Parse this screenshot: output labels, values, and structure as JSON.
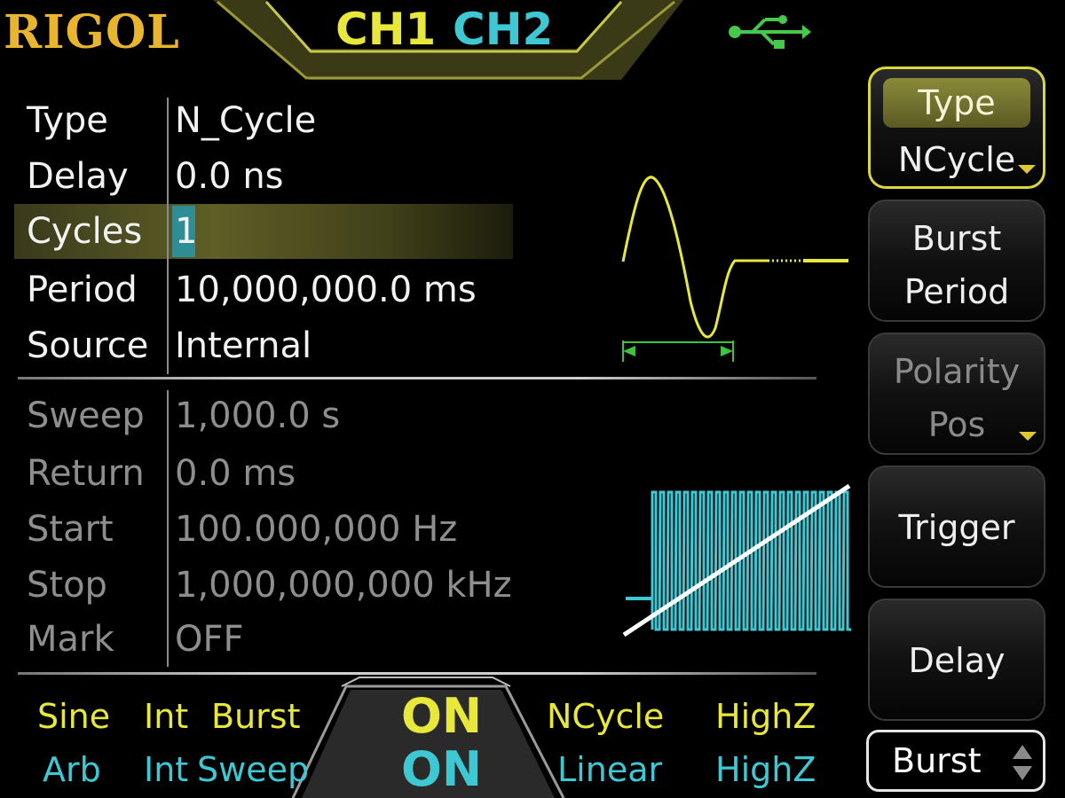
{
  "header": {
    "logo": "RIGOL",
    "channel1": "CH1",
    "channel2": "CH2",
    "usb_icon": "usb-icon",
    "colors": {
      "ch1": "#e8e83a",
      "ch2": "#3ec8d4",
      "logo": "#e8b52c"
    }
  },
  "burst": {
    "rows": [
      {
        "label": "Type",
        "value": "N_Cycle"
      },
      {
        "label": "Delay",
        "value": "0.0 ns"
      },
      {
        "label": "Cycles",
        "value": "1"
      },
      {
        "label": "Period",
        "value": "10,000,000.0 ms"
      },
      {
        "label": "Source",
        "value": "Internal"
      }
    ]
  },
  "sweep": {
    "rows": [
      {
        "label": "Sweep",
        "value": "1,000.0 s"
      },
      {
        "label": "Return",
        "value": "0.0 ms"
      },
      {
        "label": "Start",
        "value": "100.000,000 Hz"
      },
      {
        "label": "Stop",
        "value": "1,000,000,000 kHz"
      },
      {
        "label": "Mark",
        "value": "OFF"
      }
    ]
  },
  "softkeys": [
    {
      "line1": "Type",
      "line2": "NCycle"
    },
    {
      "line1": "Burst",
      "line2": "Period"
    },
    {
      "line1": "Polarity",
      "line2": "Pos"
    },
    {
      "line1": "Trigger"
    },
    {
      "line1": "Delay"
    }
  ],
  "mode_selector": "Burst",
  "footer": {
    "ch1": {
      "wave": "Sine",
      "source": "Int",
      "mode": "Burst",
      "output": "ON",
      "submode": "NCycle",
      "load": "HighZ"
    },
    "ch2": {
      "wave": "Arb",
      "source": "Int",
      "mode": "Sweep",
      "output": "ON",
      "submode": "Linear",
      "load": "HighZ"
    }
  }
}
